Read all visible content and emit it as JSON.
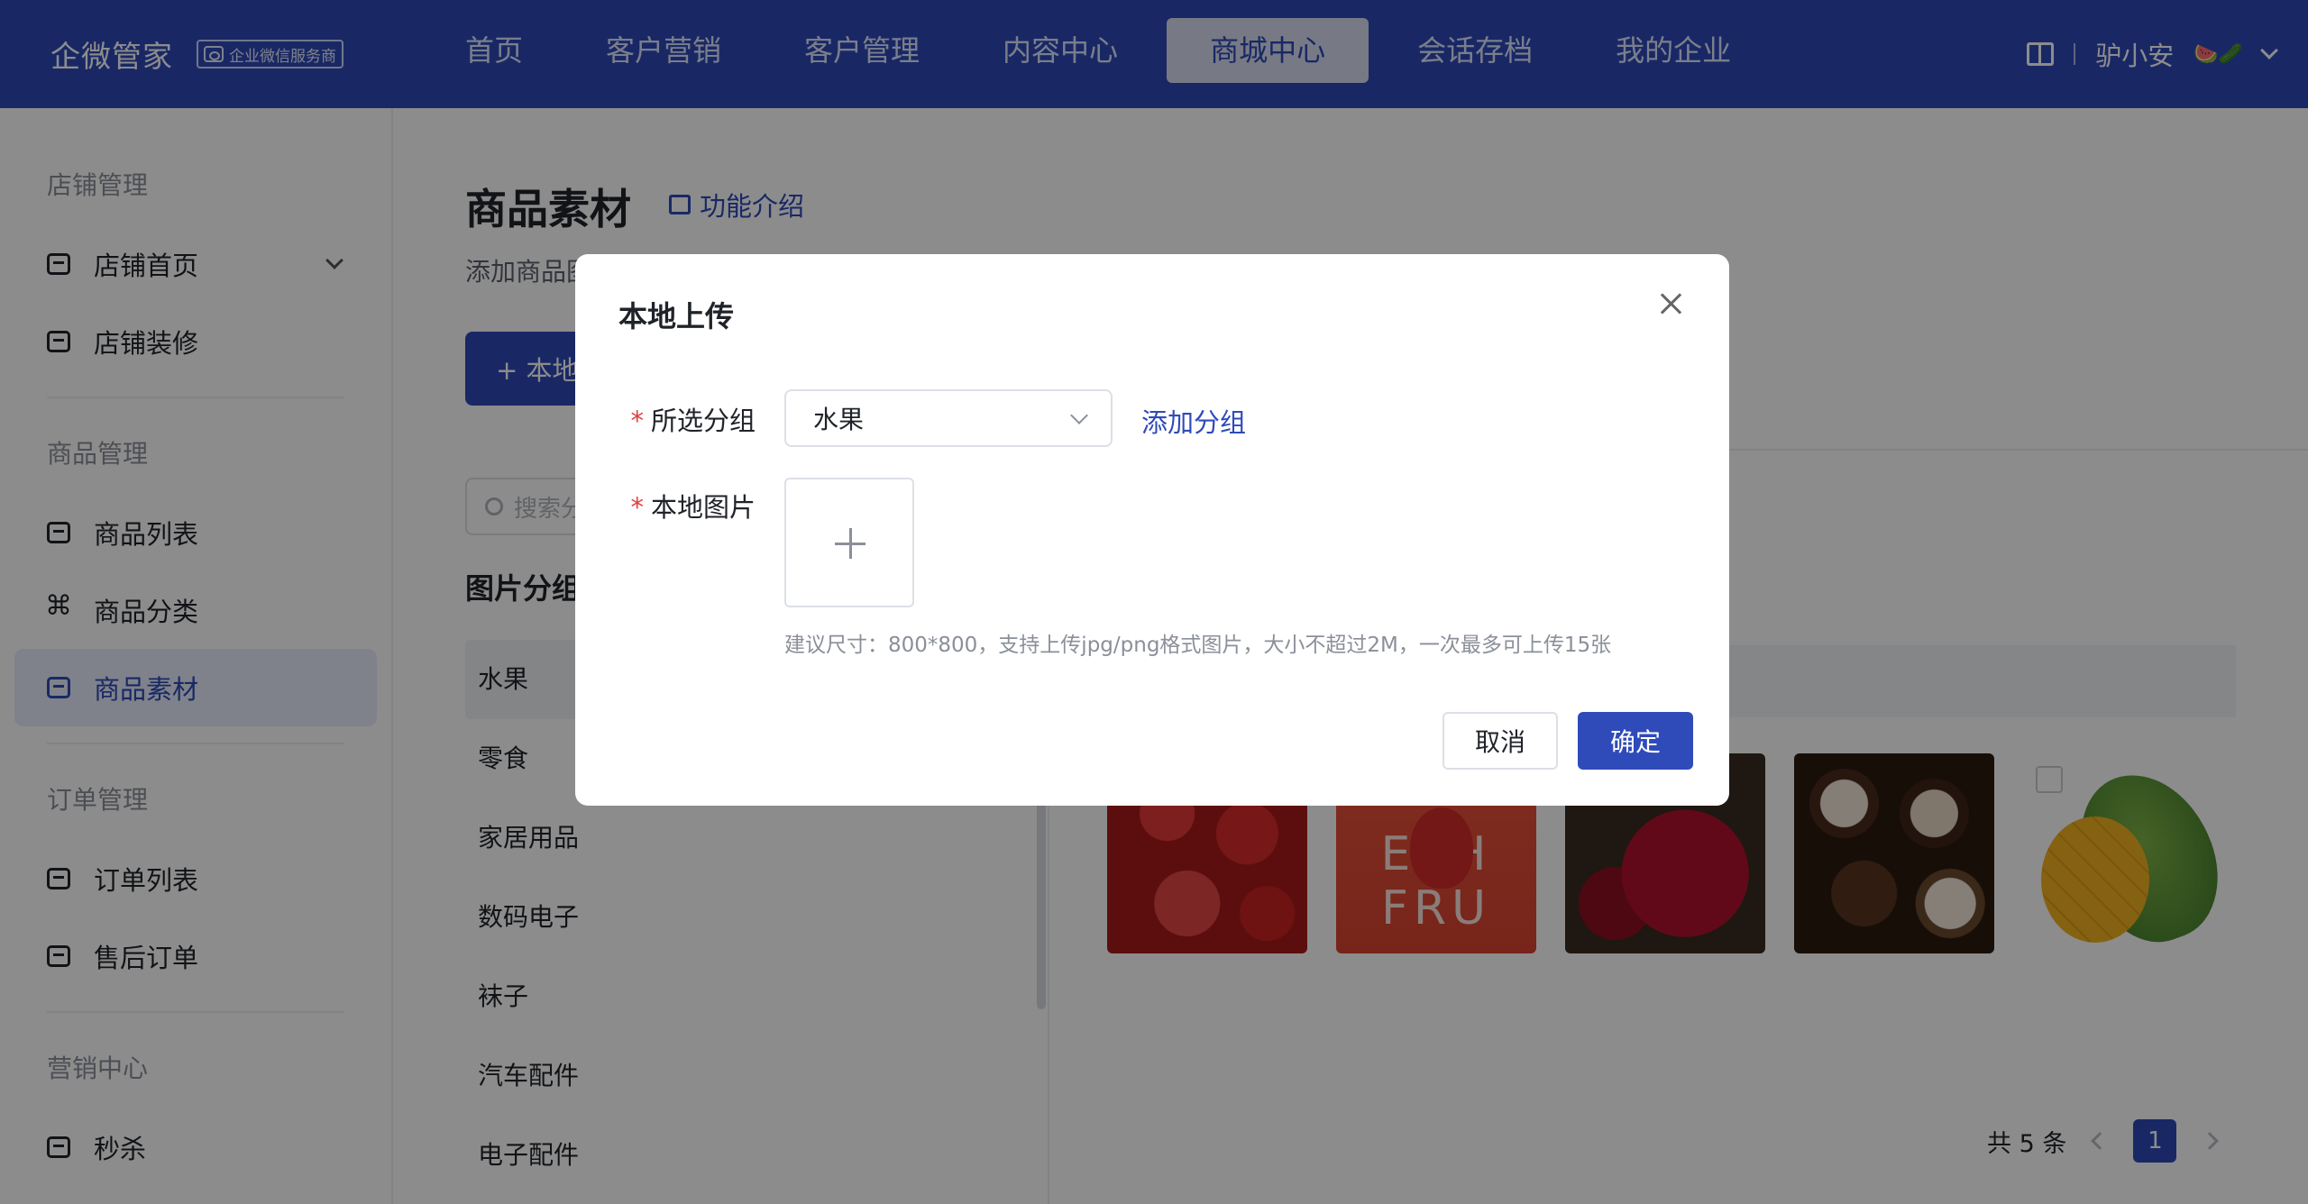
{
  "header": {
    "brand": "企微管家",
    "badge": "企业微信服务商",
    "nav": [
      "首页",
      "客户营销",
      "客户管理",
      "内容中心",
      "商城中心",
      "会话存档",
      "我的企业"
    ],
    "active_nav": "商城中心",
    "user_name": "驴小安",
    "user_emoji": "🍉🥒"
  },
  "sidebar": {
    "groups": [
      {
        "title": "店铺管理",
        "items": [
          "店铺首页",
          "店铺装修"
        ]
      },
      {
        "title": "商品管理",
        "items": [
          "商品列表",
          "商品分类",
          "商品素材"
        ]
      },
      {
        "title": "订单管理",
        "items": [
          "订单列表",
          "售后订单"
        ]
      },
      {
        "title": "营销中心",
        "items": [
          "秒杀"
        ]
      }
    ],
    "active": "商品素材"
  },
  "main": {
    "title": "商品素材",
    "intro_link": "功能介绍",
    "description": "添加商品图",
    "upload_button": "+ 本地",
    "search_placeholder": "搜索分",
    "group_title": "图片分组",
    "groups": [
      "水果",
      "零食",
      "家居用品",
      "数码电子",
      "袜子",
      "汽车配件",
      "电子配件"
    ],
    "active_group": "水果",
    "thumb_text": "ESH  FRU",
    "pagination": {
      "total": "共 5 条",
      "current": "1"
    }
  },
  "modal": {
    "title": "本地上传",
    "group_label": "所选分组",
    "group_value": "水果",
    "add_group": "添加分组",
    "image_label": "本地图片",
    "hint": "建议尺寸：800*800，支持上传jpg/png格式图片，大小不超过2M，一次最多可上传15张",
    "cancel": "取消",
    "confirm": "确定",
    "required_mark": "*"
  }
}
